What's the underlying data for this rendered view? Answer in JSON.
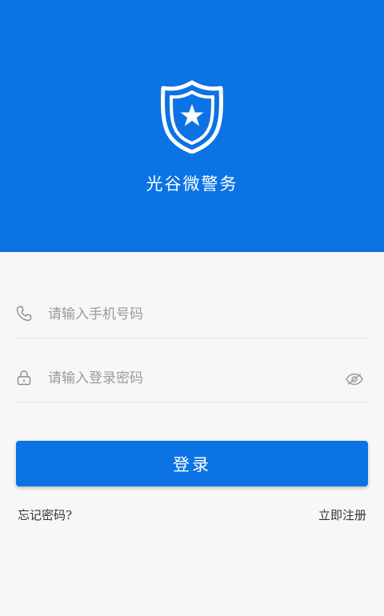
{
  "header": {
    "app_title": "光谷微警务",
    "badge_icon": "police-badge-star-icon",
    "background_color": "#0b73e4"
  },
  "form": {
    "phone": {
      "placeholder": "请输入手机号码",
      "icon": "phone-icon"
    },
    "password": {
      "placeholder": "请输入登录密码",
      "icon": "lock-icon",
      "toggle_icon": "eye-slash-icon"
    },
    "login_label": "登录",
    "forgot_label": "忘记密码?",
    "register_label": "立即注册"
  }
}
